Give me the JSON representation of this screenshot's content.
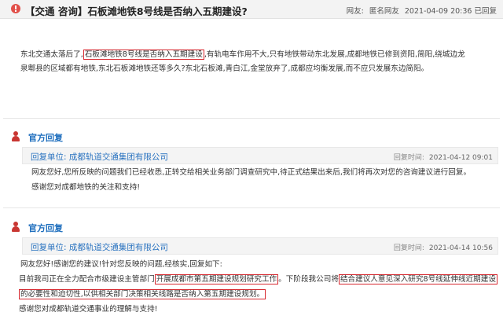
{
  "post": {
    "title": "【交通 咨询】石板滩地铁8号线是否纳入五期建设?",
    "netizen_label": "网友:",
    "netizen_name": "匿名网友",
    "datetime": "2021-04-09 20:36 已回复",
    "body_parts": [
      "东北交通太落后了,",
      "石板滩地铁8号线是否纳入五期建设",
      ",有轨电车作用不大,只有地铁带动东北发展,成都地铁已修到资阳,简阳,绕城边龙",
      "泉郫县的区域都有地铁,东北石板滩地铁还等多久?东北石板滩,青白江,金堂放弃了,成都应均衡发展,而不应只发展东边简阳。"
    ]
  },
  "replies": [
    {
      "title": "官方回复",
      "unit_label": "回复单位:",
      "unit_name": "成都轨道交通集团有限公司",
      "time_label": "回复时间:",
      "time": "2021-04-12 09:01",
      "lines": [
        "网友您好,您所反映的问题我们已经收悉,正转交给相关业务部门调查研究中,待正式结果出来后,我们将再次对您的咨询建议进行回复。",
        "感谢您对成都地铁的关注和支持!"
      ]
    },
    {
      "title": "官方回复",
      "unit_label": "回复单位:",
      "unit_name": "成都轨道交通集团有限公司",
      "time_label": "回复时间:",
      "time": "2021-04-14 10:56",
      "line1": "网友您好!感谢您的建议!针对您反映的问题,经核实,回复如下:",
      "line2_parts": [
        "目前我司正在全力配合市级建设主管部门",
        "开展成都市第五期建设规划研究工作",
        "。下阶段我公司将",
        "结合建议人意见深入研究8号线延伸线近期建设"
      ],
      "line3_parts": [
        "的必要性和迫切性,以供相关部门决策相关线路是否纳入第五期建设规划。"
      ],
      "line4": "感谢您对成都轨道交通事业的理解与支持!"
    }
  ],
  "colors": {
    "highlight_border": "#d7282f",
    "reply_title": "#1c6dbd",
    "unit_link": "#2a73c0",
    "person_icon": "#c93632",
    "header_bg": "#f3f3f3"
  },
  "icons": [
    "alert-badge-icon",
    "person-icon"
  ]
}
